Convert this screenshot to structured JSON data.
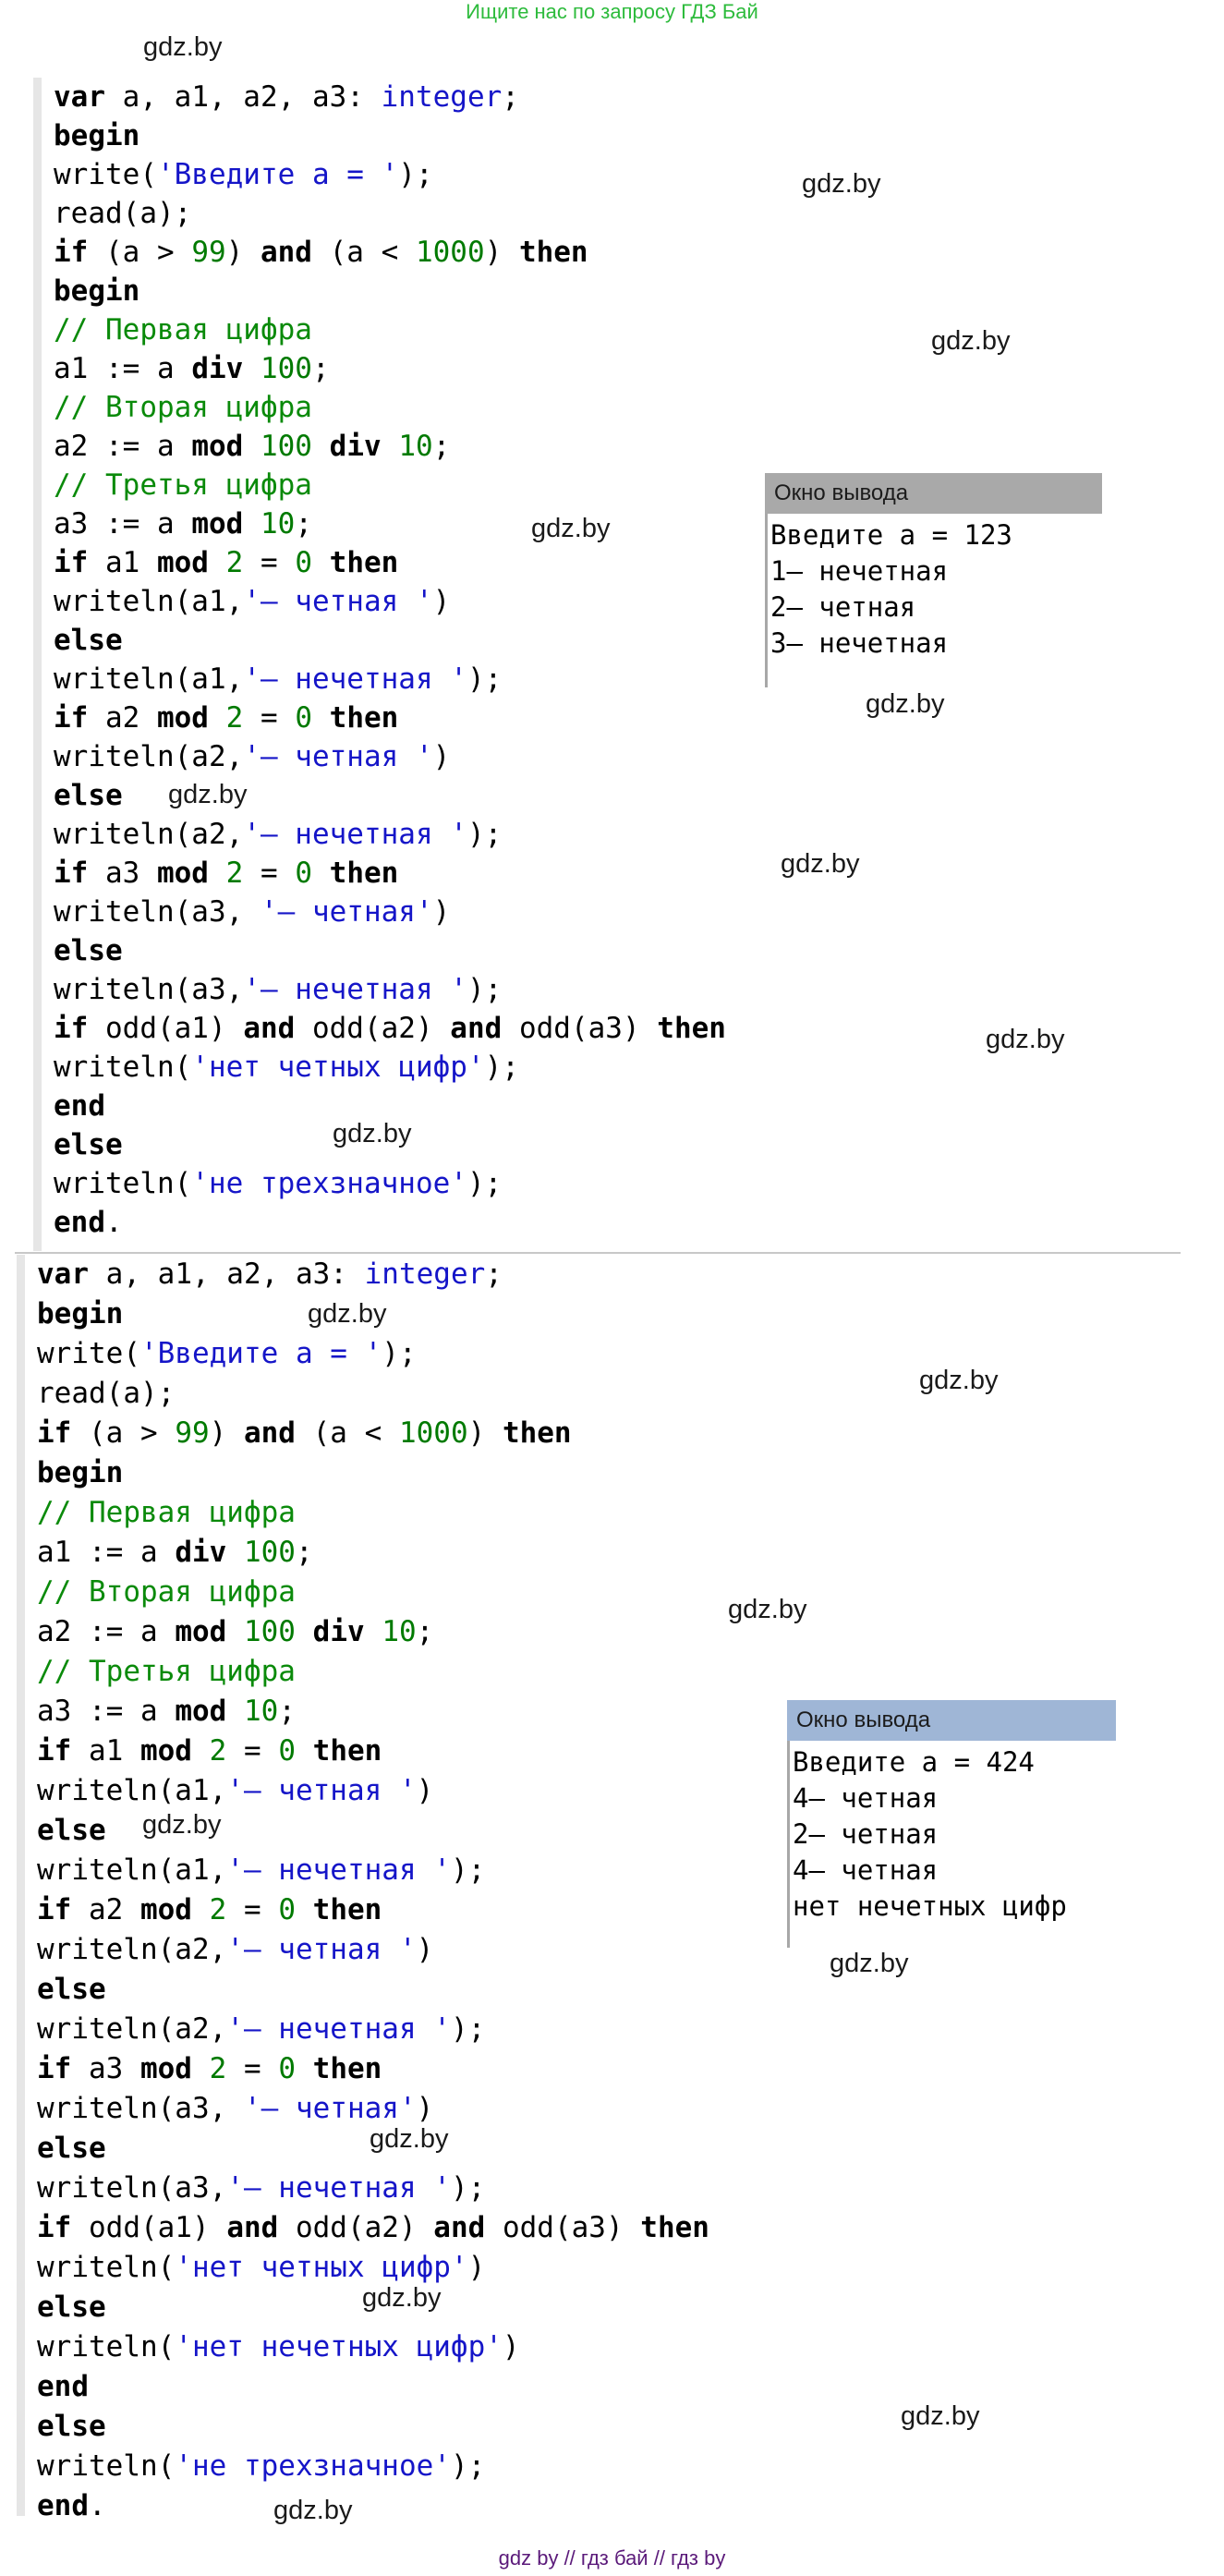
{
  "banner": "Ищите нас по запросу ГДЗ Бай",
  "footer": "gdz by  //  гдз бай  //  гдз by",
  "watermark": "gdz.by",
  "program1": [
    [
      [
        "kw",
        "var"
      ],
      [
        "t",
        " a, a1, a2, a3: "
      ],
      [
        "type",
        "integer"
      ],
      [
        "t",
        ";"
      ]
    ],
    [
      [
        "kw",
        "begin"
      ]
    ],
    [
      [
        "t",
        "write("
      ],
      [
        "str",
        "'Введите a = '"
      ],
      [
        "t",
        ");"
      ]
    ],
    [
      [
        "t",
        "read(a);"
      ]
    ],
    [
      [
        "kw",
        "if"
      ],
      [
        "t",
        " (a > "
      ],
      [
        "num",
        "99"
      ],
      [
        "t",
        ") "
      ],
      [
        "kw",
        "and"
      ],
      [
        "t",
        " (a < "
      ],
      [
        "num",
        "1000"
      ],
      [
        "t",
        ") "
      ],
      [
        "kw",
        "then"
      ]
    ],
    [
      [
        "kw",
        "begin"
      ]
    ],
    [
      [
        "cmt",
        "// Первая цифра"
      ]
    ],
    [
      [
        "t",
        "a1 := a "
      ],
      [
        "kw",
        "div"
      ],
      [
        "t",
        " "
      ],
      [
        "num",
        "100"
      ],
      [
        "t",
        ";"
      ]
    ],
    [
      [
        "cmt",
        "// Вторая цифра"
      ]
    ],
    [
      [
        "t",
        "a2 := a "
      ],
      [
        "kw",
        "mod"
      ],
      [
        "t",
        " "
      ],
      [
        "num",
        "100"
      ],
      [
        "t",
        " "
      ],
      [
        "kw",
        "div"
      ],
      [
        "t",
        " "
      ],
      [
        "num",
        "10"
      ],
      [
        "t",
        ";"
      ]
    ],
    [
      [
        "cmt",
        "// Третья цифра"
      ]
    ],
    [
      [
        "t",
        "a3 := a "
      ],
      [
        "kw",
        "mod"
      ],
      [
        "t",
        " "
      ],
      [
        "num",
        "10"
      ],
      [
        "t",
        ";"
      ]
    ],
    [
      [
        "kw",
        "if"
      ],
      [
        "t",
        " a1 "
      ],
      [
        "kw",
        "mod"
      ],
      [
        "t",
        " "
      ],
      [
        "num",
        "2"
      ],
      [
        "t",
        " = "
      ],
      [
        "num",
        "0"
      ],
      [
        "t",
        " "
      ],
      [
        "kw",
        "then"
      ]
    ],
    [
      [
        "t",
        "writeln(a1,"
      ],
      [
        "str",
        "'– четная '"
      ],
      [
        "t",
        ")"
      ]
    ],
    [
      [
        "kw",
        "else"
      ]
    ],
    [
      [
        "t",
        "writeln(a1,"
      ],
      [
        "str",
        "'– нечетная '"
      ],
      [
        "t",
        ");"
      ]
    ],
    [
      [
        "kw",
        "if"
      ],
      [
        "t",
        " a2 "
      ],
      [
        "kw",
        "mod"
      ],
      [
        "t",
        " "
      ],
      [
        "num",
        "2"
      ],
      [
        "t",
        " = "
      ],
      [
        "num",
        "0"
      ],
      [
        "t",
        " "
      ],
      [
        "kw",
        "then"
      ]
    ],
    [
      [
        "t",
        "writeln(a2,"
      ],
      [
        "str",
        "'– четная '"
      ],
      [
        "t",
        ")"
      ]
    ],
    [
      [
        "kw",
        "else"
      ]
    ],
    [
      [
        "t",
        "writeln(a2,"
      ],
      [
        "str",
        "'– нечетная '"
      ],
      [
        "t",
        ");"
      ]
    ],
    [
      [
        "kw",
        "if"
      ],
      [
        "t",
        " a3 "
      ],
      [
        "kw",
        "mod"
      ],
      [
        "t",
        " "
      ],
      [
        "num",
        "2"
      ],
      [
        "t",
        " = "
      ],
      [
        "num",
        "0"
      ],
      [
        "t",
        " "
      ],
      [
        "kw",
        "then"
      ]
    ],
    [
      [
        "t",
        "writeln(a3, "
      ],
      [
        "str",
        "'– четная'"
      ],
      [
        "t",
        ")"
      ]
    ],
    [
      [
        "kw",
        "else"
      ]
    ],
    [
      [
        "t",
        "writeln(a3,"
      ],
      [
        "str",
        "'– нечетная '"
      ],
      [
        "t",
        ");"
      ]
    ],
    [
      [
        "kw",
        "if"
      ],
      [
        "t",
        " odd(a1) "
      ],
      [
        "kw",
        "and"
      ],
      [
        "t",
        " odd(a2) "
      ],
      [
        "kw",
        "and"
      ],
      [
        "t",
        " odd(a3) "
      ],
      [
        "kw",
        "then"
      ]
    ],
    [
      [
        "t",
        "writeln("
      ],
      [
        "str",
        "'нет четных цифр'"
      ],
      [
        "t",
        ");"
      ]
    ],
    [
      [
        "kw",
        "end"
      ]
    ],
    [
      [
        "kw",
        "else"
      ]
    ],
    [
      [
        "t",
        "writeln("
      ],
      [
        "str",
        "'не трехзначное'"
      ],
      [
        "t",
        ");"
      ]
    ],
    [
      [
        "kw",
        "end"
      ],
      [
        "t",
        "."
      ]
    ]
  ],
  "program2": [
    [
      [
        "kw",
        "var"
      ],
      [
        "t",
        " a, a1, a2, a3: "
      ],
      [
        "type",
        "integer"
      ],
      [
        "t",
        ";"
      ]
    ],
    [
      [
        "kw",
        "begin"
      ]
    ],
    [
      [
        "t",
        "write("
      ],
      [
        "str",
        "'Введите a = '"
      ],
      [
        "t",
        ");"
      ]
    ],
    [
      [
        "t",
        "read(a);"
      ]
    ],
    [
      [
        "kw",
        "if"
      ],
      [
        "t",
        " (a > "
      ],
      [
        "num",
        "99"
      ],
      [
        "t",
        ") "
      ],
      [
        "kw",
        "and"
      ],
      [
        "t",
        " (a < "
      ],
      [
        "num",
        "1000"
      ],
      [
        "t",
        ") "
      ],
      [
        "kw",
        "then"
      ]
    ],
    [
      [
        "kw",
        "begin"
      ]
    ],
    [
      [
        "cmt",
        "// Первая цифра"
      ]
    ],
    [
      [
        "t",
        "a1 := a "
      ],
      [
        "kw",
        "div"
      ],
      [
        "t",
        " "
      ],
      [
        "num",
        "100"
      ],
      [
        "t",
        ";"
      ]
    ],
    [
      [
        "cmt",
        "// Вторая цифра"
      ]
    ],
    [
      [
        "t",
        "a2 := a "
      ],
      [
        "kw",
        "mod"
      ],
      [
        "t",
        " "
      ],
      [
        "num",
        "100"
      ],
      [
        "t",
        " "
      ],
      [
        "kw",
        "div"
      ],
      [
        "t",
        " "
      ],
      [
        "num",
        "10"
      ],
      [
        "t",
        ";"
      ]
    ],
    [
      [
        "cmt",
        "// Третья цифра"
      ]
    ],
    [
      [
        "t",
        "a3 := a "
      ],
      [
        "kw",
        "mod"
      ],
      [
        "t",
        " "
      ],
      [
        "num",
        "10"
      ],
      [
        "t",
        ";"
      ]
    ],
    [
      [
        "kw",
        "if"
      ],
      [
        "t",
        " a1 "
      ],
      [
        "kw",
        "mod"
      ],
      [
        "t",
        " "
      ],
      [
        "num",
        "2"
      ],
      [
        "t",
        " = "
      ],
      [
        "num",
        "0"
      ],
      [
        "t",
        " "
      ],
      [
        "kw",
        "then"
      ]
    ],
    [
      [
        "t",
        "writeln(a1,"
      ],
      [
        "str",
        "'– четная '"
      ],
      [
        "t",
        ")"
      ]
    ],
    [
      [
        "kw",
        "else"
      ]
    ],
    [
      [
        "t",
        "writeln(a1,"
      ],
      [
        "str",
        "'– нечетная '"
      ],
      [
        "t",
        ");"
      ]
    ],
    [
      [
        "kw",
        "if"
      ],
      [
        "t",
        " a2 "
      ],
      [
        "kw",
        "mod"
      ],
      [
        "t",
        " "
      ],
      [
        "num",
        "2"
      ],
      [
        "t",
        " = "
      ],
      [
        "num",
        "0"
      ],
      [
        "t",
        " "
      ],
      [
        "kw",
        "then"
      ]
    ],
    [
      [
        "t",
        "writeln(a2,"
      ],
      [
        "str",
        "'– четная '"
      ],
      [
        "t",
        ")"
      ]
    ],
    [
      [
        "kw",
        "else"
      ]
    ],
    [
      [
        "t",
        "writeln(a2,"
      ],
      [
        "str",
        "'– нечетная '"
      ],
      [
        "t",
        ");"
      ]
    ],
    [
      [
        "kw",
        "if"
      ],
      [
        "t",
        " a3 "
      ],
      [
        "kw",
        "mod"
      ],
      [
        "t",
        " "
      ],
      [
        "num",
        "2"
      ],
      [
        "t",
        " = "
      ],
      [
        "num",
        "0"
      ],
      [
        "t",
        " "
      ],
      [
        "kw",
        "then"
      ]
    ],
    [
      [
        "t",
        "writeln(a3, "
      ],
      [
        "str",
        "'– четная'"
      ],
      [
        "t",
        ")"
      ]
    ],
    [
      [
        "kw",
        "else"
      ]
    ],
    [
      [
        "t",
        "writeln(a3,"
      ],
      [
        "str",
        "'– нечетная '"
      ],
      [
        "t",
        ");"
      ]
    ],
    [
      [
        "kw",
        "if"
      ],
      [
        "t",
        " odd(a1) "
      ],
      [
        "kw",
        "and"
      ],
      [
        "t",
        " odd(a2) "
      ],
      [
        "kw",
        "and"
      ],
      [
        "t",
        " odd(a3) "
      ],
      [
        "kw",
        "then"
      ]
    ],
    [
      [
        "t",
        "writeln("
      ],
      [
        "str",
        "'нет четных цифр'"
      ],
      [
        "t",
        ")"
      ]
    ],
    [
      [
        "kw",
        "else"
      ]
    ],
    [
      [
        "t",
        "writeln("
      ],
      [
        "str",
        "'нет нечетных цифр'"
      ],
      [
        "t",
        ")"
      ]
    ],
    [
      [
        "kw",
        "end"
      ]
    ],
    [
      [
        "kw",
        "else"
      ]
    ],
    [
      [
        "t",
        "writeln("
      ],
      [
        "str",
        "'не трехзначное'"
      ],
      [
        "t",
        ");"
      ]
    ],
    [
      [
        "kw",
        "end"
      ],
      [
        "t",
        "."
      ]
    ]
  ],
  "output1": {
    "title": "Окно вывода",
    "title_bg": "#a9a9a9",
    "lines": [
      "Введите a = 123",
      "1– нечетная",
      "2– четная",
      "3– нечетная"
    ]
  },
  "output2": {
    "title": "Окно вывода",
    "title_bg": "#9fb6d6",
    "lines": [
      "Введите a = 424",
      "4– четная",
      "2– четная",
      "4– четная",
      "нет нечетных цифр"
    ]
  },
  "colors": {
    "keyword": "#000000",
    "string": "#1515c8",
    "number": "#007a00",
    "comment": "#0a8a0a",
    "banner": "#2dbb3c",
    "footer": "#5b1a7a"
  }
}
